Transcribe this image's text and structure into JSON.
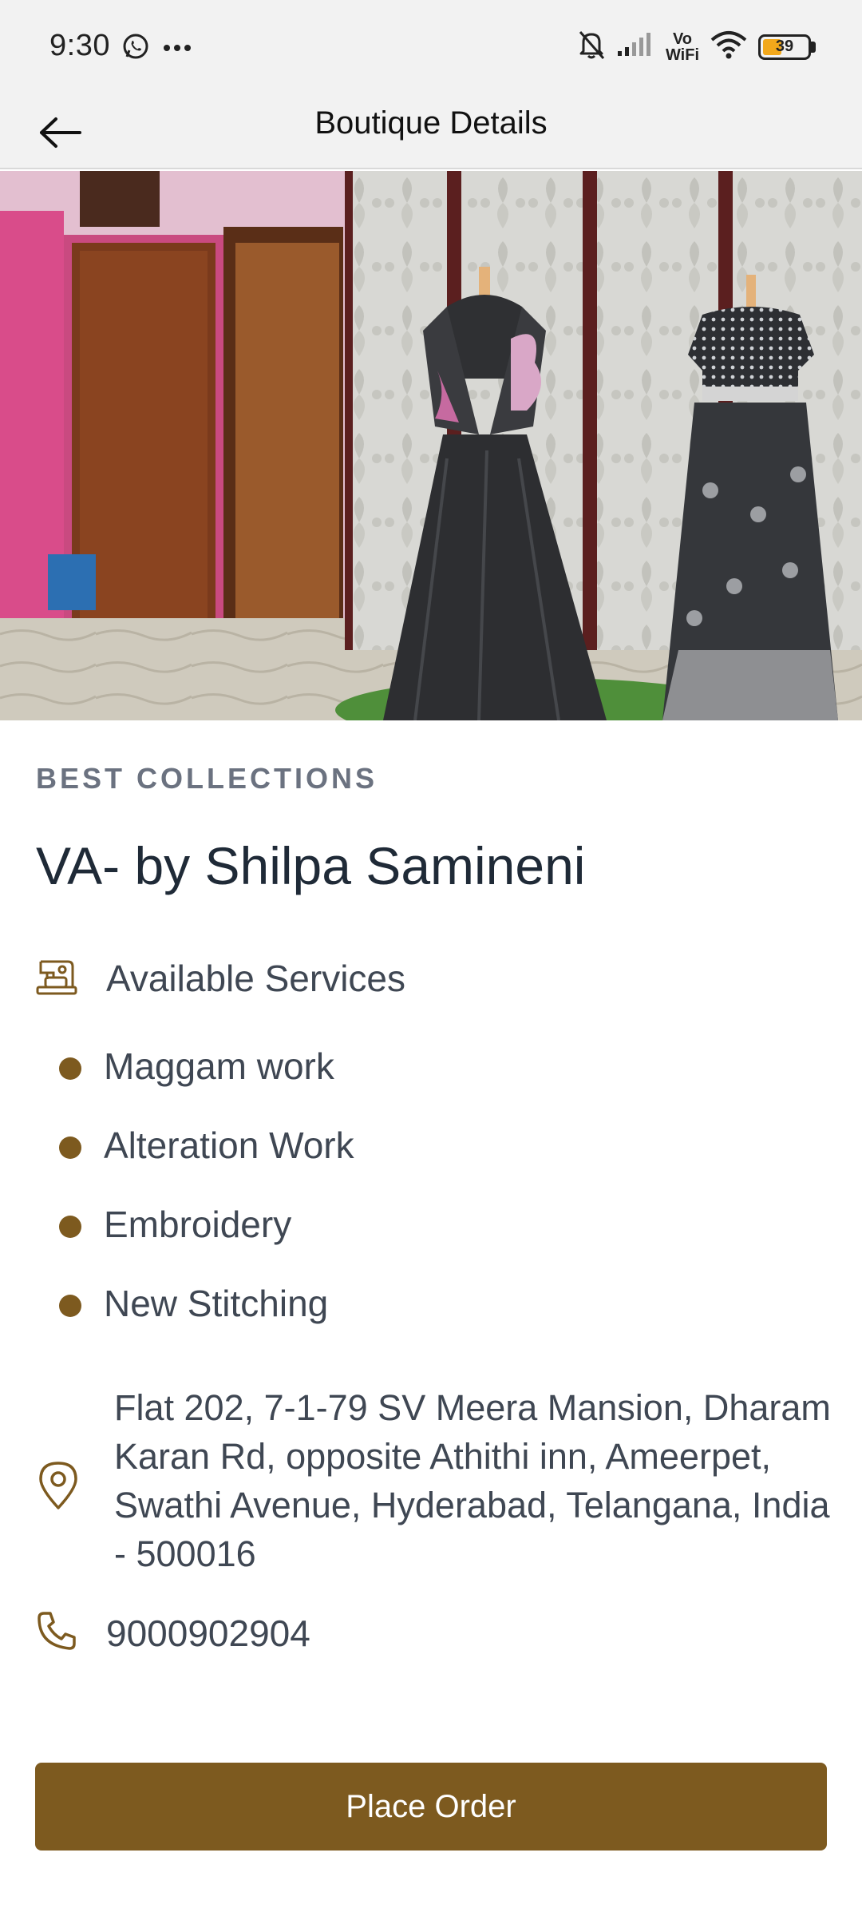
{
  "status_bar": {
    "time": "9:30",
    "network_label_top": "Vo",
    "network_label_bottom": "WiFi",
    "battery_text": "39",
    "battery_level": 0.39
  },
  "app_bar": {
    "title": "Boutique Details",
    "back_icon": "arrow-left-icon"
  },
  "hero": {
    "icon": "boutique-photo"
  },
  "boutique": {
    "eyebrow": "BEST COLLECTIONS",
    "name": "VA- by Shilpa Samineni",
    "services_label": "Available Services",
    "services": [
      "Maggam work",
      "Alteration Work",
      "Embroidery",
      "New Stitching"
    ],
    "address": "Flat 202, 7-1-79 SV Meera Mansion, Dharam Karan Rd, opposite Athithi inn, Ameerpet, Swathi Avenue, Hyderabad, Telangana, India - 500016",
    "phone": "9000902904"
  },
  "actions": {
    "place_order": "Place Order"
  },
  "colors": {
    "accent": "#7d5a1f",
    "text": "#3f4753",
    "heading": "#1f2a37",
    "eyebrow": "#6b7280",
    "bar_bg": "#f2f2f2"
  }
}
